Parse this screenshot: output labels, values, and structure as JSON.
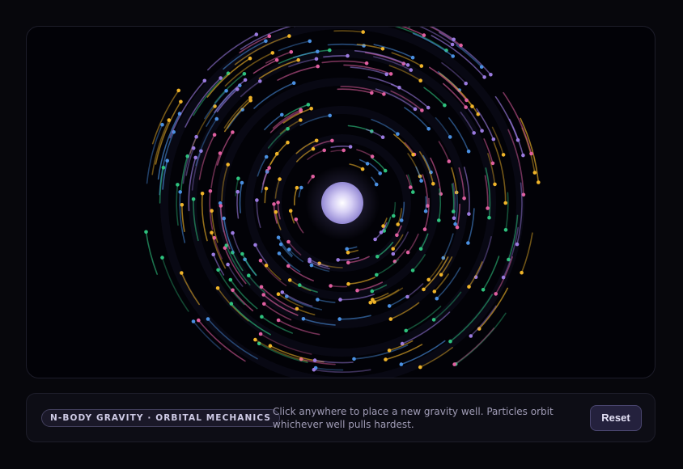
{
  "simulation": {
    "well_colors": [
      "#ffffff",
      "#d6cff5",
      "#9388d4"
    ],
    "particle_colors": [
      "#f0b429",
      "#4a90e2",
      "#2ec27e",
      "#e05fa0",
      "#9b7be0"
    ]
  },
  "panel": {
    "badge_label": "N-BODY GRAVITY · ORBITAL MECHANICS",
    "description": "Click anywhere to place a new gravity well. Particles orbit whichever well pulls hardest.",
    "reset_label": "Reset"
  }
}
